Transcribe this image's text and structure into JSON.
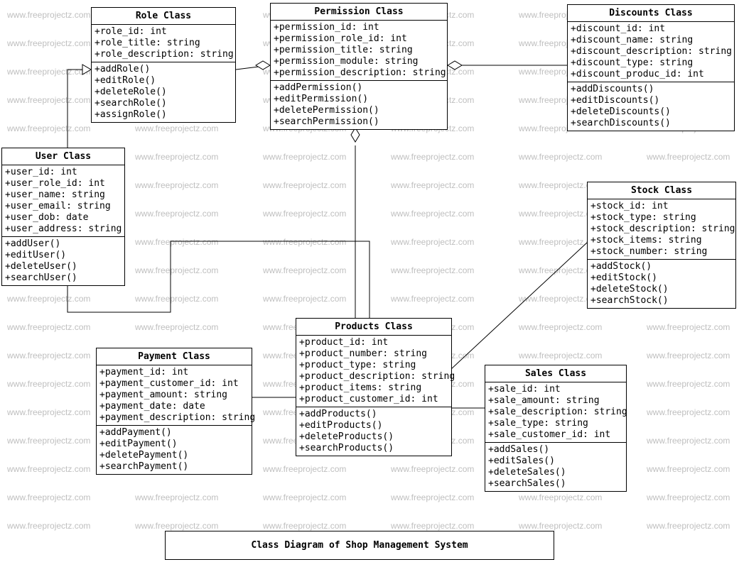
{
  "watermark_text": "www.freeprojectz.com",
  "caption": "Class Diagram of Shop Management System",
  "classes": {
    "role": {
      "title": "Role Class",
      "attrs": [
        "+role_id: int",
        "+role_title: string",
        "+role_description: string"
      ],
      "ops": [
        "+addRole()",
        "+editRole()",
        "+deleteRole()",
        "+searchRole()",
        "+assignRole()"
      ]
    },
    "permission": {
      "title": "Permission Class",
      "attrs": [
        "+permission_id: int",
        "+permission_role_id: int",
        "+permission_title: string",
        "+permission_module: string",
        "+permission_description: string"
      ],
      "ops": [
        "+addPermission()",
        "+editPermission()",
        "+deletePermission()",
        "+searchPermission()"
      ]
    },
    "discounts": {
      "title": "Discounts Class",
      "attrs": [
        "+discount_id: int",
        "+discount_name: string",
        "+discount_description: string",
        "+discount_type: string",
        "+discount_produc_id: int"
      ],
      "ops": [
        "+addDiscounts()",
        "+editDiscounts()",
        "+deleteDiscounts()",
        "+searchDiscounts()"
      ]
    },
    "user": {
      "title": "User Class",
      "attrs": [
        "+user_id: int",
        "+user_role_id: int",
        "+user_name: string",
        "+user_email: string",
        "+user_dob: date",
        "+user_address: string"
      ],
      "ops": [
        "+addUser()",
        "+editUser()",
        "+deleteUser()",
        "+searchUser()"
      ]
    },
    "stock": {
      "title": "Stock Class",
      "attrs": [
        "+stock_id: int",
        "+stock_type: string",
        "+stock_description: string",
        "+stock_items: string",
        "+stock_number: string"
      ],
      "ops": [
        "+addStock()",
        "+editStock()",
        "+deleteStock()",
        "+searchStock()"
      ]
    },
    "products": {
      "title": "Products  Class",
      "attrs": [
        "+product_id: int",
        "+product_number: string",
        "+product_type: string",
        "+product_description: string",
        "+product_items: string",
        "+product_customer_id: int"
      ],
      "ops": [
        "+addProducts()",
        "+editProducts()",
        "+deleteProducts()",
        "+searchProducts()"
      ]
    },
    "payment": {
      "title": "Payment Class",
      "attrs": [
        "+payment_id: int",
        "+payment_customer_id: int",
        "+payment_amount: string",
        "+payment_date: date",
        "+payment_description: string"
      ],
      "ops": [
        "+addPayment()",
        "+editPayment()",
        "+deletePayment()",
        "+searchPayment()"
      ]
    },
    "sales": {
      "title": "Sales Class",
      "attrs": [
        "+sale_id: int",
        "+sale_amount: string",
        "+sale_description: string",
        "+sale_type: string",
        "+sale_customer_id: int"
      ],
      "ops": [
        "+addSales()",
        "+editSales()",
        "+deleteSales()",
        "+searchSales()"
      ]
    }
  }
}
